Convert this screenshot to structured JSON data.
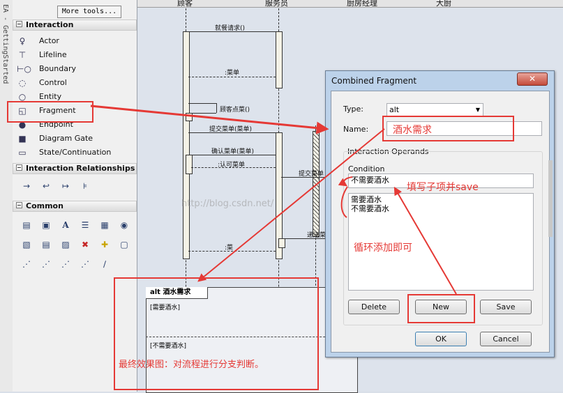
{
  "sidebar_tab": {
    "label": "EA - GettingStarted"
  },
  "toolbox": {
    "more_tools": "More tools...",
    "sections": {
      "interaction": "Interaction",
      "relationships": "Interaction Relationships",
      "common": "Common"
    },
    "items": [
      {
        "label": "Actor",
        "icon": "actor-icon"
      },
      {
        "label": "Lifeline",
        "icon": "lifeline-icon"
      },
      {
        "label": "Boundary",
        "icon": "boundary-icon"
      },
      {
        "label": "Control",
        "icon": "control-icon"
      },
      {
        "label": "Entity",
        "icon": "entity-icon"
      },
      {
        "label": "Fragment",
        "icon": "fragment-icon"
      },
      {
        "label": "Endpoint",
        "icon": "endpoint-icon"
      },
      {
        "label": "Diagram Gate",
        "icon": "diagram-gate-icon"
      },
      {
        "label": "State/Continuation",
        "icon": "state-continuation-icon"
      }
    ]
  },
  "diagram": {
    "columns": [
      "顾客",
      "服务员",
      "厨房经理",
      "大厨"
    ],
    "messages": {
      "m1": "就餐请求()",
      "m2": ":菜单",
      "m3": "顾客点菜()",
      "m4": "提交菜单(菜单)",
      "m5": "确认菜单(菜单)",
      "m6": ":认可菜单",
      "m7": "提交菜单",
      "m8": "递送菜",
      "m9": ":菜"
    },
    "watermark": "http://blog.csdn.net/",
    "fragment": {
      "tag": "alt 酒水需求",
      "guard1": "[需要酒水]",
      "guard2": "[不需要酒水]"
    }
  },
  "dialog": {
    "title": "Combined Fragment",
    "close": "✕",
    "type_label": "Type:",
    "type_value": "alt",
    "name_label": "Name:",
    "name_value": "",
    "operands_label": "Interaction Operands",
    "condition_label": "Condition",
    "condition_value": "不需要酒水",
    "operand_list": [
      "需要酒水",
      "不需要酒水"
    ],
    "delete_btn": "Delete",
    "new_btn": "New",
    "save_btn": "Save",
    "ok_btn": "OK",
    "cancel_btn": "Cancel"
  },
  "annotations": {
    "name_note": "酒水需求",
    "fill_note": "填写子项并save",
    "loop_note": "循环添加即可",
    "final_note": "最终效果图：对流程进行分支判断。"
  },
  "colors": {
    "annotation_red": "#e53935",
    "dialog_frame": "#bcd2ea"
  }
}
